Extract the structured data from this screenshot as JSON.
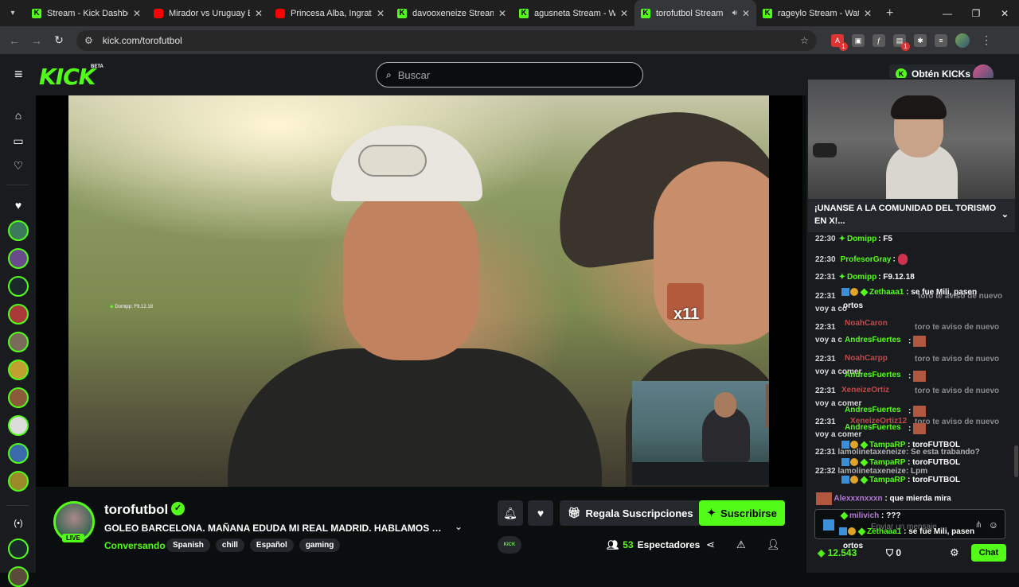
{
  "browser": {
    "tabs": [
      {
        "title": "Stream - Kick Dashboa",
        "icon": "kick"
      },
      {
        "title": "Mirador vs Uruguay Bu",
        "icon": "youtube"
      },
      {
        "title": "Princesa Alba, Ingrata",
        "icon": "youtube"
      },
      {
        "title": "davooxeneize Stream",
        "icon": "kick"
      },
      {
        "title": "agusneta Stream - Wa",
        "icon": "kick"
      },
      {
        "title": "torofutbol Stream",
        "icon": "kick",
        "active": true
      },
      {
        "title": "rageylo Stream - Watc",
        "icon": "kick"
      }
    ],
    "url": "kick.com/torofutbol",
    "extension_badges": [
      "1",
      "1"
    ]
  },
  "header": {
    "logo": "KICK",
    "logo_badge": "BETA",
    "search_placeholder": "Buscar",
    "get_kicks": "Obtén KICKs"
  },
  "video": {
    "overlay_chat_user": "Domipp",
    "overlay_chat_text": ": F9.12.18",
    "emote_multiplier": "x11"
  },
  "stream": {
    "channel": "torofutbol",
    "live_label": "LIVE",
    "title": "GOLEO BARCELONA. MAÑANA EDUDA MI REAL MADRID. HABLAMOS DE FUTBOL",
    "category": "Conversando",
    "tags": [
      "Spanish",
      "chill",
      "Español",
      "gaming"
    ],
    "gift_label": "Regala Suscripciones",
    "subscribe_label": "Suscribirse",
    "viewers_count": "53",
    "viewers_label": "Espectadores",
    "kick_mini": "KICK"
  },
  "chat": {
    "pinned": "¡UNANSE A LA COMUNIDAD DEL TORISMO EN X!...",
    "messages": [
      {
        "time": "22:30",
        "user": "Domipp",
        "text": ": F5"
      },
      {
        "time": "22:30",
        "user": "ProfesorGray",
        "text": ":"
      },
      {
        "time": "22:31",
        "user": "Domipp",
        "text": ": F9.12.18"
      }
    ],
    "overlap_lines": {
      "l1_time": "22:31",
      "l1_user": "Zethaaa1",
      "l1_text": ": se fue Mili, pasen",
      "l1_ghost": "toro te aviso de nuevo",
      "l1_b": "voy a co",
      "l1_c": "ortos",
      "l2_time": "22:31",
      "l2_user_red": "NoahCaron",
      "l2_ghost": "toro te aviso de nuevo",
      "l2_b": "voy a c",
      "l2_user": "AndresFuertes",
      "l2_text": ":",
      "l3_time": "22:31",
      "l3_user_red": "NoahCarpp",
      "l3_ghost": "toro te aviso de nuevo",
      "l3_b": "voy a comer",
      "l3_user": "AndresFuertes",
      "l3_text": ":",
      "l4_time": "22:31",
      "l4_user_red": "XeneizeOrtiz",
      "l4_ghost": "toro te aviso de nuevo",
      "l4_b": "voy a comer",
      "l4_user": "AndresFuertes",
      "l4_text": ":",
      "l5_time": "22:31",
      "l5_user_red": "XeneizeOrtiz12",
      "l5_ghost": "toro te aviso de nuevo",
      "l5_b": "voy a comer",
      "l5_user": "AndresFuertes",
      "l5_text": ":",
      "l6_time": "22:31",
      "l6_u1": "lamolinetaxeneize",
      "l6_t1": ": Se esta trabando?",
      "l6_user": "TampaRP",
      "l6_text": ": toroFUTBOL",
      "l7_time": "22:32",
      "l7_u1": "lamolinetaxeneize",
      "l7_t1": ": Lpm",
      "l7_user": "TampaRP",
      "l7_text": ": toroFUTBOL",
      "l8_user": "TampaRP",
      "l8_text": ": toroFUTBOL",
      "l9_user": "Alexxxnxxxn",
      "l9_text": ": que mierda mira",
      "l10_user": "milivich",
      "l10_text": ": ???",
      "l11_user": "Zethaaa1",
      "l11_text": ": se fue Mili, pasen",
      "l11_b": "ortos"
    },
    "input_placeholder": "Enviar un mensaje",
    "kicks_balance": "12.543",
    "subs_count": "0",
    "chat_button": "Chat"
  },
  "colors": {
    "brand_green": "#53fc18",
    "bg": "#0b0e0f",
    "panel": "#191b1f"
  }
}
